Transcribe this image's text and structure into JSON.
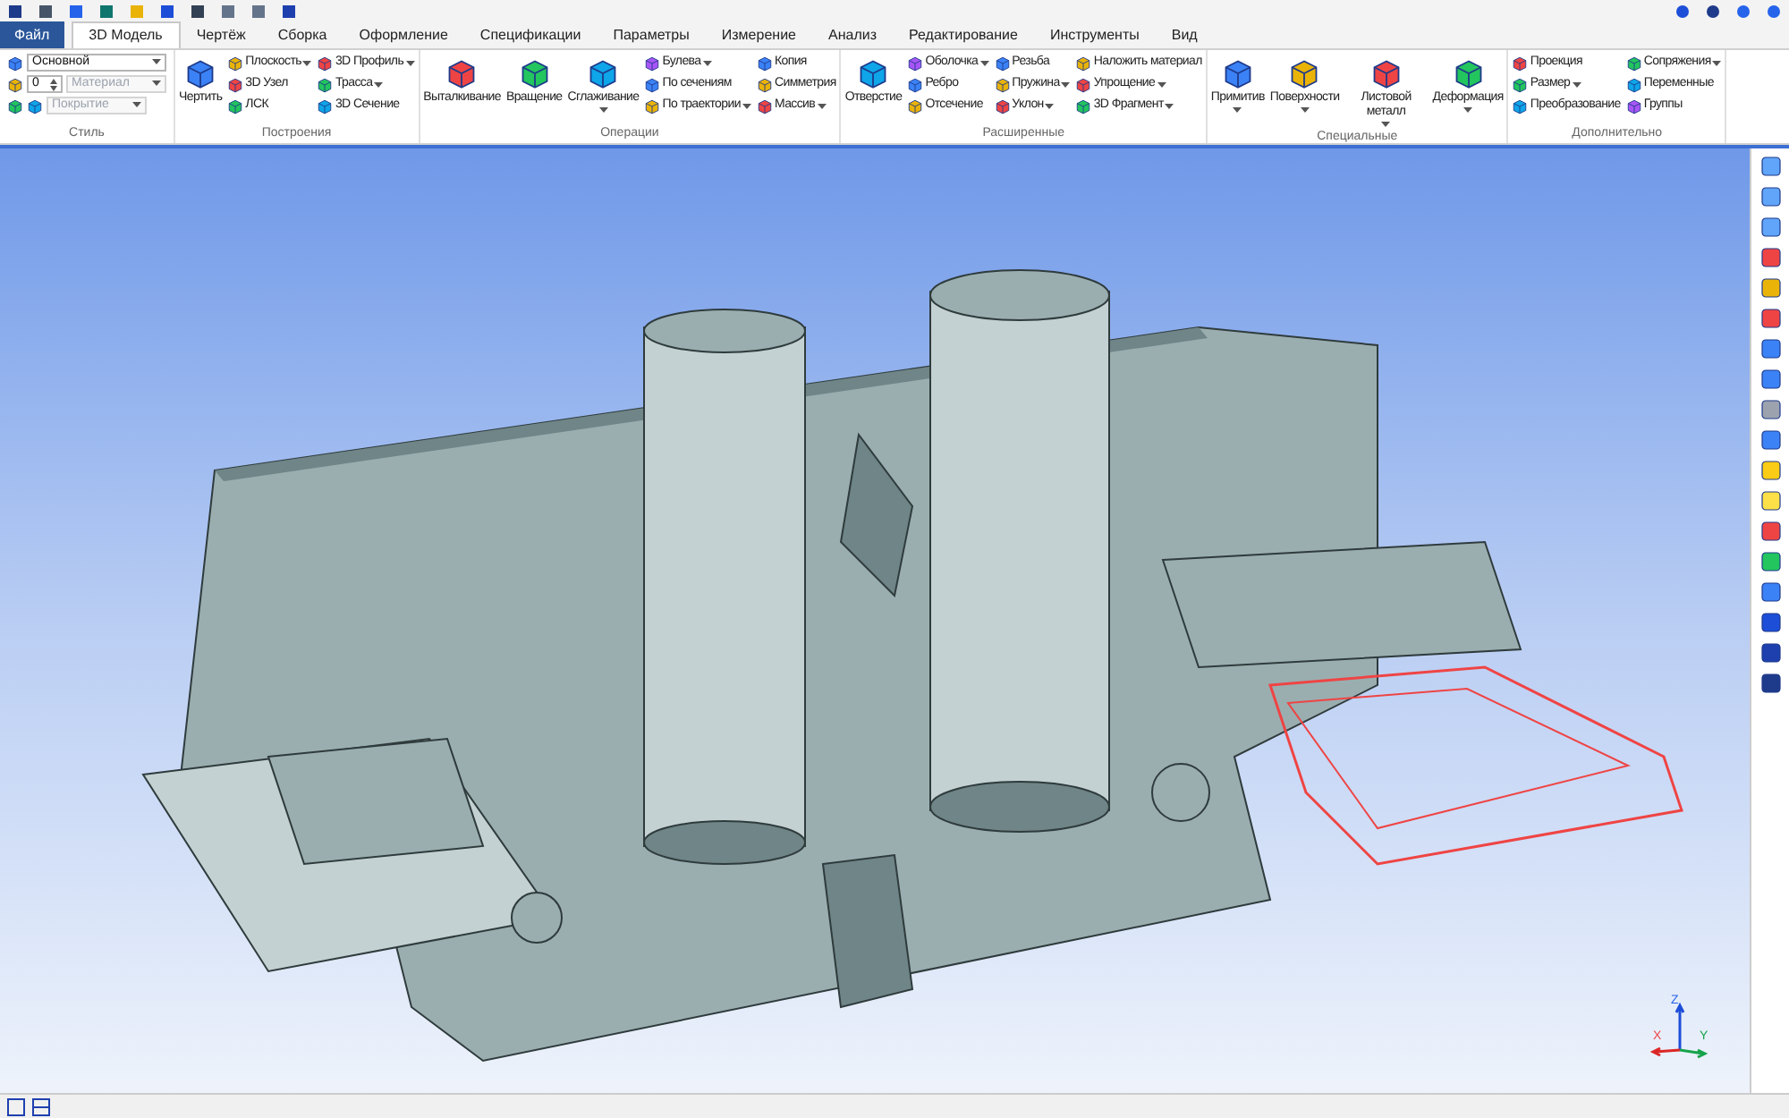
{
  "tabs": [
    {
      "label": "Файл",
      "kind": "file",
      "selected": false
    },
    {
      "label": "3D Модель",
      "kind": "tab",
      "selected": true
    },
    {
      "label": "Чертёж",
      "kind": "tab",
      "selected": false
    },
    {
      "label": "Сборка",
      "kind": "tab",
      "selected": false
    },
    {
      "label": "Оформление",
      "kind": "tab",
      "selected": false
    },
    {
      "label": "Спецификации",
      "kind": "tab",
      "selected": false
    },
    {
      "label": "Параметры",
      "kind": "tab",
      "selected": false
    },
    {
      "label": "Измерение",
      "kind": "tab",
      "selected": false
    },
    {
      "label": "Анализ",
      "kind": "tab",
      "selected": false
    },
    {
      "label": "Редактирование",
      "kind": "tab",
      "selected": false
    },
    {
      "label": "Инструменты",
      "kind": "tab",
      "selected": false
    },
    {
      "label": "Вид",
      "kind": "tab",
      "selected": false
    }
  ],
  "style_group": {
    "title": "Стиль",
    "fields": [
      {
        "value": "Основной",
        "disabled": false,
        "kind": "combo"
      },
      {
        "value": "0",
        "disabled": false,
        "kind": "spin"
      },
      {
        "value": "Материал",
        "disabled": true,
        "kind": "combo"
      },
      {
        "value": "Покрытие",
        "disabled": true,
        "kind": "combo"
      }
    ]
  },
  "groups": [
    {
      "title": "Построения",
      "columns": [
        [
          {
            "label": "Чертить",
            "kind": "large",
            "dropdown": false
          }
        ],
        [
          {
            "label": "Плоскость",
            "kind": "small",
            "dropdown": true
          },
          {
            "label": "3D Узел",
            "kind": "small",
            "dropdown": false
          },
          {
            "label": "ЛСК",
            "kind": "small",
            "dropdown": false
          }
        ],
        [
          {
            "label": "3D Профиль",
            "kind": "small",
            "dropdown": true
          },
          {
            "label": "Трасса",
            "kind": "small",
            "dropdown": true
          },
          {
            "label": "3D Сечение",
            "kind": "small",
            "dropdown": false
          }
        ]
      ]
    },
    {
      "title": "Операции",
      "columns": [
        [
          {
            "label": "Выталкивание",
            "kind": "large",
            "dropdown": false
          }
        ],
        [
          {
            "label": "Вращение",
            "kind": "large",
            "dropdown": false
          }
        ],
        [
          {
            "label": "Сглаживание",
            "kind": "large",
            "dropdown": true
          }
        ],
        [
          {
            "label": "Булева",
            "kind": "small",
            "dropdown": true
          },
          {
            "label": "По сечениям",
            "kind": "small",
            "dropdown": false
          },
          {
            "label": "По траектории",
            "kind": "small",
            "dropdown": true
          }
        ],
        [
          {
            "label": "Копия",
            "kind": "small",
            "dropdown": false
          },
          {
            "label": "Симметрия",
            "kind": "small",
            "dropdown": false
          },
          {
            "label": "Массив",
            "kind": "small",
            "dropdown": true
          }
        ]
      ]
    },
    {
      "title": "Расширенные",
      "columns": [
        [
          {
            "label": "Отверстие",
            "kind": "large",
            "dropdown": false
          }
        ],
        [
          {
            "label": "Оболочка",
            "kind": "small",
            "dropdown": true
          },
          {
            "label": "Ребро",
            "kind": "small",
            "dropdown": false
          },
          {
            "label": "Отсечение",
            "kind": "small",
            "dropdown": false
          }
        ],
        [
          {
            "label": "Резьба",
            "kind": "small",
            "dropdown": false
          },
          {
            "label": "Пружина",
            "kind": "small",
            "dropdown": true
          },
          {
            "label": "Уклон",
            "kind": "small",
            "dropdown": true
          }
        ],
        [
          {
            "label": "Наложить материал",
            "kind": "small",
            "dropdown": false
          },
          {
            "label": "Упрощение",
            "kind": "small",
            "dropdown": true
          },
          {
            "label": "3D Фрагмент",
            "kind": "small",
            "dropdown": true
          }
        ]
      ]
    },
    {
      "title": "Специальные",
      "columns": [
        [
          {
            "label": "Примитив",
            "kind": "large",
            "dropdown": true
          }
        ],
        [
          {
            "label": "Поверхности",
            "kind": "large",
            "dropdown": true
          }
        ],
        [
          {
            "label": "Листовой металл",
            "kind": "large",
            "dropdown": true
          }
        ],
        [
          {
            "label": "Деформация",
            "kind": "large",
            "dropdown": true
          }
        ]
      ]
    },
    {
      "title": "Дополнительно",
      "columns": [
        [
          {
            "label": "Проекция",
            "kind": "small",
            "dropdown": false
          },
          {
            "label": "Размер",
            "kind": "small",
            "dropdown": true
          },
          {
            "label": "Преобразование",
            "kind": "small",
            "dropdown": false
          }
        ],
        [
          {
            "label": "Сопряжения",
            "kind": "small",
            "dropdown": true
          },
          {
            "label": "Переменные",
            "kind": "small",
            "dropdown": false
          },
          {
            "label": "Группы",
            "kind": "small",
            "dropdown": false
          }
        ]
      ]
    }
  ],
  "axes": {
    "x": "X",
    "y": "Y",
    "z": "Z"
  }
}
